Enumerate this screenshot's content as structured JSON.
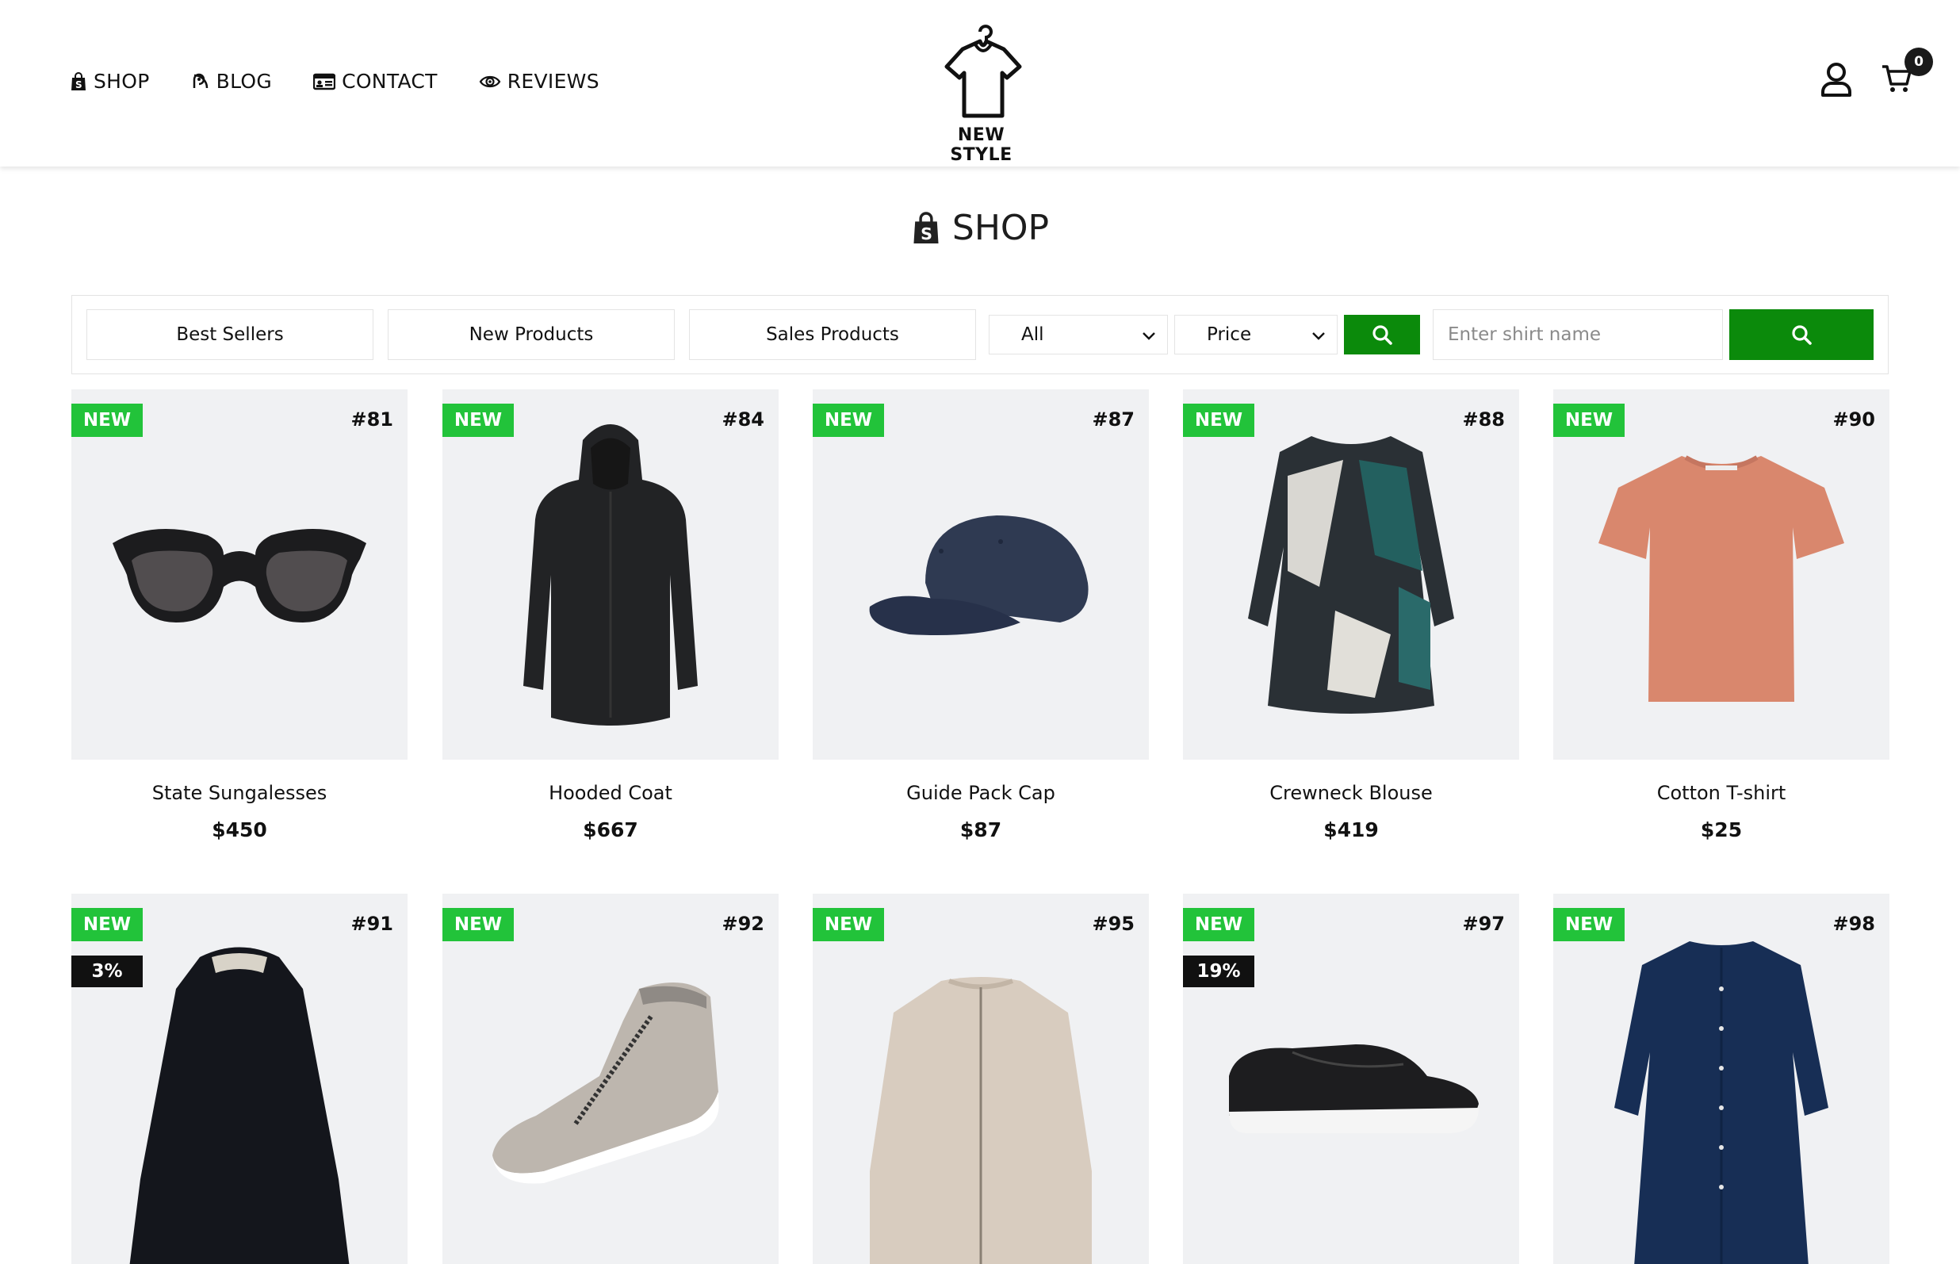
{
  "nav": {
    "items": [
      {
        "label": "SHOP",
        "icon": "shopify-bag-icon"
      },
      {
        "label": "BLOG",
        "icon": "blog-icon"
      },
      {
        "label": "CONTACT",
        "icon": "contact-card-icon"
      },
      {
        "label": "REVIEWS",
        "icon": "eye-icon"
      }
    ]
  },
  "brand": {
    "name": "NEW STYLE",
    "icon": "hanger-shirt-icon"
  },
  "cart": {
    "count": "0"
  },
  "page": {
    "title": "SHOP"
  },
  "filters": {
    "tabs": [
      "Best Sellers",
      "New Products",
      "Sales Products"
    ],
    "category_selected": "All",
    "price_selected": "Price",
    "search_placeholder": "Enter shirt name"
  },
  "colors": {
    "accent_green": "#0b8a0b",
    "badge_new": "#22c33a",
    "badge_discount": "#111111",
    "card_bg": "#f0f1f3"
  },
  "products": [
    {
      "name": "State Sungalesses",
      "price": "$450",
      "id": "#81",
      "badge": "NEW",
      "discount": ""
    },
    {
      "name": "Hooded Coat",
      "price": "$667",
      "id": "#84",
      "badge": "NEW",
      "discount": ""
    },
    {
      "name": "Guide Pack Cap",
      "price": "$87",
      "id": "#87",
      "badge": "NEW",
      "discount": ""
    },
    {
      "name": "Crewneck Blouse",
      "price": "$419",
      "id": "#88",
      "badge": "NEW",
      "discount": ""
    },
    {
      "name": "Cotton T-shirt",
      "price": "$25",
      "id": "#90",
      "badge": "NEW",
      "discount": ""
    },
    {
      "name": "",
      "price": "",
      "id": "#91",
      "badge": "NEW",
      "discount": "3%"
    },
    {
      "name": "",
      "price": "",
      "id": "#92",
      "badge": "NEW",
      "discount": ""
    },
    {
      "name": "",
      "price": "",
      "id": "#95",
      "badge": "NEW",
      "discount": ""
    },
    {
      "name": "",
      "price": "",
      "id": "#97",
      "badge": "NEW",
      "discount": "19%"
    },
    {
      "name": "",
      "price": "",
      "id": "#98",
      "badge": "NEW",
      "discount": ""
    }
  ]
}
